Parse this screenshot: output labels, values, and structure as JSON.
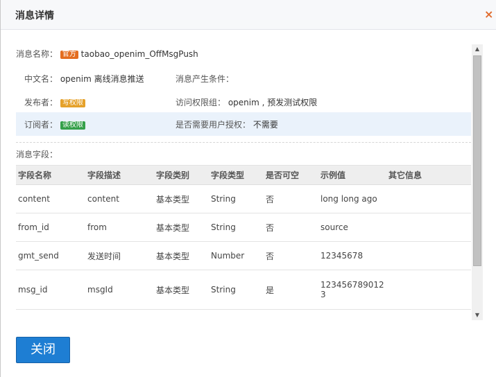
{
  "dialog": {
    "title": "消息详情",
    "close_icon": "×"
  },
  "message": {
    "name_label": "消息名称：",
    "official_badge": "官方",
    "name_value": "taobao_openim_OffMsgPush",
    "cn_name_label": "中文名：",
    "cn_name_value": "openim 离线消息推送",
    "condition_label": "消息产生条件：",
    "publisher_label": "发布者：",
    "publisher_badge": "写权限",
    "access_group_label": "访问权限组：",
    "access_group_value": "openim , 预发测试权限",
    "subscriber_label": "订阅者：",
    "subscriber_badge": "读权限",
    "auth_label": "是否需要用户授权：",
    "auth_value": "不需要"
  },
  "fields": {
    "section_label": "消息字段：",
    "headers": [
      "字段名称",
      "字段描述",
      "字段类别",
      "字段类型",
      "是否可空",
      "示例值",
      "其它信息"
    ],
    "rows": [
      [
        "content",
        "content",
        "基本类型",
        "String",
        "否",
        "long long ago",
        ""
      ],
      [
        "from_id",
        "from",
        "基本类型",
        "String",
        "否",
        "source",
        ""
      ],
      [
        "gmt_send",
        "发送时间",
        "基本类型",
        "Number",
        "否",
        "12345678",
        ""
      ],
      [
        "msg_id",
        "msgId",
        "基本类型",
        "String",
        "是",
        "1234567890123",
        ""
      ]
    ]
  },
  "footer": {
    "close_button": "关闭"
  },
  "colors": {
    "primary_button": "#1e7ed3",
    "official_badge": "#e46d1f",
    "write_badge": "#e5a12a",
    "read_badge": "#35a04a",
    "highlight_row": "#eaf2fb"
  }
}
